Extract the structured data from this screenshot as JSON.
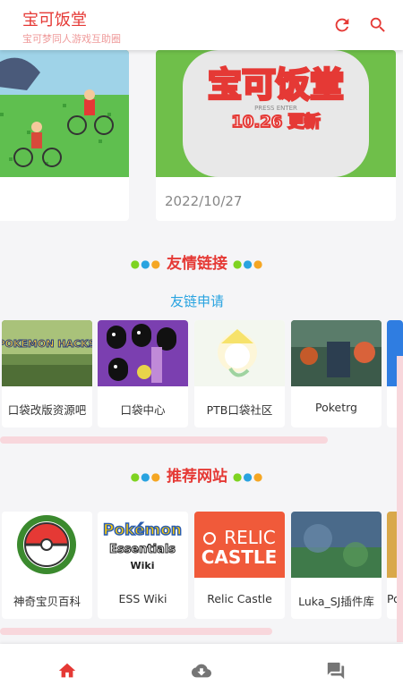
{
  "header": {
    "title": "宝可饭堂",
    "subtitle": "宝可梦同人游戏互助圈",
    "refresh_icon": "refresh-icon",
    "search_icon": "search-icon"
  },
  "news": {
    "right_card_date": "2022/10/27",
    "banner_title": "宝可饭堂",
    "banner_sub": "10.26 更新",
    "banner_press": "PRESS ENTER"
  },
  "friend_links": {
    "title": "友情链接",
    "apply_label": "友链申请",
    "items": [
      {
        "label": "口袋改版资源吧"
      },
      {
        "label": "口袋中心"
      },
      {
        "label": "PTB口袋社区"
      },
      {
        "label": "Poketrg"
      }
    ]
  },
  "recommended": {
    "title": "推荐网站",
    "items": [
      {
        "label": "神奇宝贝百科"
      },
      {
        "label": "ESS Wiki"
      },
      {
        "label": "Relic Castle"
      },
      {
        "label": "Luka_SJ插件库"
      },
      {
        "label": "Po"
      }
    ],
    "ess_logo_line1": "Pokémon",
    "ess_logo_line2": "Essentials",
    "ess_logo_line3": "Wiki",
    "relic_line1": "RELIC",
    "relic_line2": "CASTLE",
    "pokehacks_text": "POKEMON HACKS"
  },
  "colors": {
    "brand": "#e53935",
    "link": "#29a3e0",
    "scroll_track": "#f8d7dc"
  },
  "bottom_nav": {
    "home_icon": "home-icon",
    "download_icon": "cloud-download-icon",
    "forum_icon": "forum-icon"
  }
}
